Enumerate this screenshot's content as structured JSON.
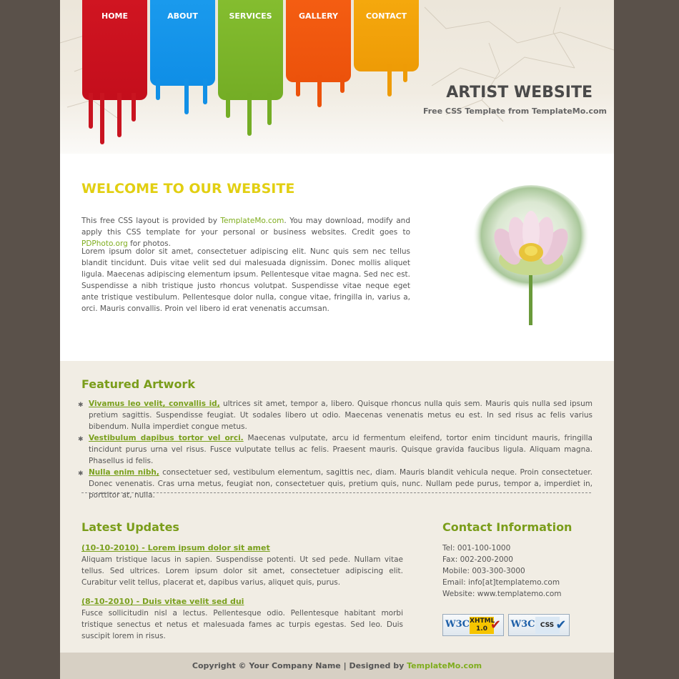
{
  "nav": {
    "items": [
      {
        "label": "HOME",
        "color": "#cc1220"
      },
      {
        "label": "ABOUT",
        "color": "#1494e8"
      },
      {
        "label": "SERVICES",
        "color": "#7bb52a"
      },
      {
        "label": "GALLERY",
        "color": "#f1560e"
      },
      {
        "label": "CONTACT",
        "color": "#f2a30a"
      }
    ]
  },
  "header": {
    "title": "ARTIST WEBSITE",
    "subtitle": "Free CSS Template from TemplateMo.com"
  },
  "welcome": {
    "heading": "WELCOME TO OUR WEBSITE",
    "p1_a": "This free CSS layout is provided by ",
    "p1_link1": "TemplateMo.com",
    "p1_b": ". You may download, modify and apply this CSS template for your personal or business websites. Credit goes to ",
    "p1_link2": "PDPhoto.org",
    "p1_c": " for photos.",
    "p2": "Lorem ipsum dolor sit amet, consectetuer adipiscing elit. Nunc quis sem nec tellus blandit tincidunt. Duis vitae velit sed dui malesuada dignissim. Donec mollis aliquet ligula. Maecenas adipiscing elementum ipsum. Pellentesque vitae magna. Sed nec est. Suspendisse a nibh tristique justo rhoncus volutpat. Suspendisse vitae neque eget ante tristique vestibulum. Pellentesque dolor nulla, congue vitae, fringilla in, varius a, orci. Mauris convallis. Proin vel libero id erat venenatis accumsan."
  },
  "featured": {
    "heading": "Featured Artwork",
    "items": [
      {
        "title": "Vivamus leo velit, convallis id,",
        "text": " ultrices sit amet, tempor a, libero. Quisque rhoncus nulla quis sem. Mauris quis nulla sed ipsum pretium sagittis. Suspendisse feugiat. Ut sodales libero ut odio. Maecenas venenatis metus eu est. In sed risus ac felis varius bibendum. Nulla imperdiet congue metus."
      },
      {
        "title": "Vestibulum dapibus tortor vel orci.",
        "text": " Maecenas vulputate, arcu id fermentum eleifend, tortor enim tincidunt mauris, fringilla tincidunt purus urna vel risus. Fusce vulputate tellus ac felis. Praesent mauris. Quisque gravida faucibus ligula. Aliquam magna. Phasellus id felis."
      },
      {
        "title": "Nulla enim nibh,",
        "text": " consectetuer sed, vestibulum elementum, sagittis nec, diam. Mauris blandit vehicula neque. Proin consectetuer. Donec venenatis. Cras urna metus, feugiat non, consectetuer quis, pretium quis, nunc. Nullam pede purus, tempor a, imperdiet in, porttitor at, nulla."
      }
    ]
  },
  "updates": {
    "heading": "Latest Updates",
    "items": [
      {
        "title": "(10-10-2010) - Lorem ipsum dolor sit amet",
        "text": "Aliquam tristique lacus in sapien. Suspendisse potenti. Ut sed pede. Nullam vitae tellus. Sed ultrices. Lorem ipsum dolor sit amet, consectetuer adipiscing elit. Curabitur velit tellus, placerat et, dapibus varius, aliquet quis, purus."
      },
      {
        "title": "(8-10-2010) - Duis vitae velit sed dui",
        "text": "Fusce sollicitudin nisl a lectus. Pellentesque odio. Pellentesque habitant morbi tristique senectus et netus et malesuada fames ac turpis egestas. Sed leo. Duis suscipit lorem in risus."
      }
    ]
  },
  "contact": {
    "heading": "Contact Information",
    "tel": "Tel: 001-100-1000",
    "fax": "Fax: 002-200-2000",
    "mobile": "Mobile: 003-300-3000",
    "email": "Email: info[at]templatemo.com",
    "website": "Website: www.templatemo.com",
    "badges": [
      {
        "w3": "W3C",
        "kind": "XHTML 1.0",
        "check": "✔",
        "check_color": "#c0201b"
      },
      {
        "w3": "W3C",
        "kind": "CSS",
        "check": "✔",
        "check_color": "#1d5fa8"
      }
    ]
  },
  "footer": {
    "copyright": "Copyright © Your Company Name",
    "sep": " | ",
    "designed_by": "Designed by ",
    "designer": "TemplateMo.com"
  }
}
